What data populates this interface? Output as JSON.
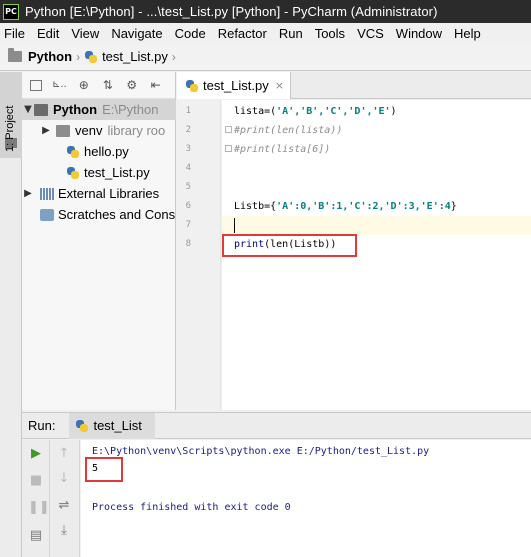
{
  "window": {
    "app_icon_text": "PC",
    "title": "Python [E:\\Python] - ...\\test_List.py [Python] - PyCharm (Administrator)"
  },
  "menu": [
    {
      "id": "file",
      "label": "File"
    },
    {
      "id": "edit",
      "label": "Edit"
    },
    {
      "id": "view",
      "label": "View"
    },
    {
      "id": "navigate",
      "label": "Navigate"
    },
    {
      "id": "code",
      "label": "Code"
    },
    {
      "id": "refactor",
      "label": "Refactor"
    },
    {
      "id": "run",
      "label": "Run"
    },
    {
      "id": "tools",
      "label": "Tools"
    },
    {
      "id": "vcs",
      "label": "VCS"
    },
    {
      "id": "window",
      "label": "Window"
    },
    {
      "id": "help",
      "label": "Help"
    }
  ],
  "breadcrumb": {
    "project": "Python",
    "file": "test_List.py",
    "separator": "›"
  },
  "toolwindow": {
    "vertical_tab": "1: Project"
  },
  "project_tree": {
    "toolbar_abbrev": "⊾..",
    "root": {
      "name": "Python",
      "path": "E:\\Python"
    },
    "venv": {
      "name": "venv",
      "note": "library roo"
    },
    "files": [
      "hello.py",
      "test_List.py"
    ],
    "external_libraries": "External Libraries",
    "scratches": "Scratches and Cons"
  },
  "editor": {
    "tab_label": "test_List.py",
    "tab_close": "×",
    "line_numbers": [
      "1",
      "2",
      "3",
      "4",
      "5",
      "6",
      "7",
      "8"
    ],
    "lines": {
      "l1_prefix": "lista=(",
      "l1_str": "'A','B','C','D','E'",
      "l1_suffix": ")",
      "l2": "#print(len(lista))",
      "l3": "#print(lista[6])",
      "l6_prefix": "Listb={",
      "l6_body": "'A':0,'B':1,'C':2,'D':3,'E':4",
      "l6_suffix": "}",
      "l8_fn": "print",
      "l8_rest": "(len(Listb))"
    }
  },
  "run_panel": {
    "label": "Run:",
    "tab": "test_List",
    "console": {
      "command": "E:\\Python\\venv\\Scripts\\python.exe E:/Python/test_List.py",
      "output": "5",
      "exit": "Process finished with exit code 0"
    }
  },
  "colors": {
    "highlight_box": "#e03a3a",
    "string_color": "#008080",
    "comment_color": "#8c8c8c",
    "console_text": "#1a1a8c",
    "run_green": "#3d9a2b"
  }
}
